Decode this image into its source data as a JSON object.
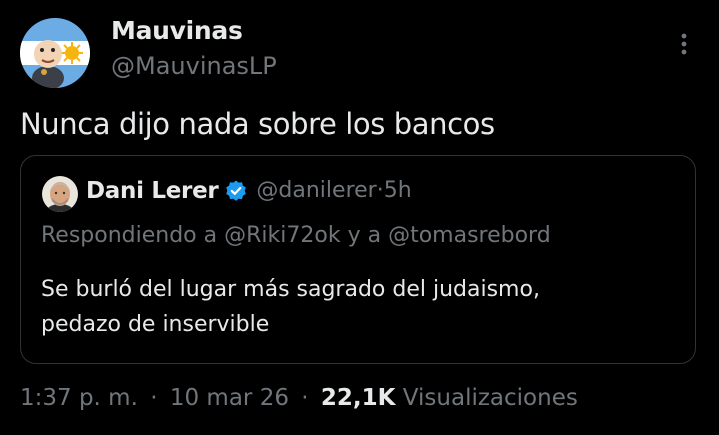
{
  "tweet": {
    "author": {
      "display_name": "Mauvinas",
      "handle": "@MauvinasLP",
      "avatar_icon": "argentina-flag-avatar-icon"
    },
    "more_icon": "more-vertical-icon",
    "text": "Nunca dijo nada sobre los bancos",
    "quoted": {
      "display_name": "Dani Lerer",
      "verified_icon": "verified-badge-icon",
      "verified_color": "#1d9bf0",
      "handle": "@danilerer",
      "separator": "·",
      "time": "5h",
      "replying_prefix": "Respondiendo a",
      "replying_user_1": "@Riki72ok",
      "replying_conjunction": "y a",
      "replying_user_2": "@tomasrebord",
      "text_line_1": "Se burló del lugar más sagrado del judaismo,",
      "text_line_2": "pedazo de inservible"
    },
    "footer": {
      "time": "1:37 p. m.",
      "separator": "·",
      "date": "10 mar 26",
      "views_count": "22,1K",
      "views_label": "Visualizaciones"
    }
  },
  "colors": {
    "background": "#000000",
    "primary_text": "#e7e9ea",
    "secondary_text": "#71767b",
    "border": "#2f3336",
    "accent": "#1d9bf0"
  }
}
